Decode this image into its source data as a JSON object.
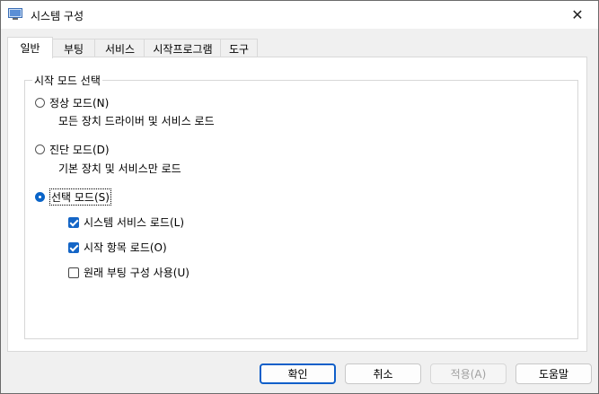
{
  "window": {
    "title": "시스템 구성",
    "close_glyph": "✕"
  },
  "tabs": [
    {
      "label": "일반",
      "active": true
    },
    {
      "label": "부팅",
      "active": false
    },
    {
      "label": "서비스",
      "active": false
    },
    {
      "label": "시작프로그램",
      "active": false
    },
    {
      "label": "도구",
      "active": false
    }
  ],
  "startup_group": {
    "legend": "시작 모드 선택",
    "normal": {
      "label": "정상 모드(N)",
      "desc": "모든 장치 드라이버 및 서비스 로드",
      "selected": false
    },
    "diagnostic": {
      "label": "진단 모드(D)",
      "desc": "기본 장치 및 서비스만 로드",
      "selected": false
    },
    "selective": {
      "label": "선택 모드(S)",
      "selected": true
    },
    "options": [
      {
        "label": "시스템 서비스 로드(L)",
        "checked": true
      },
      {
        "label": "시작 항목 로드(O)",
        "checked": true
      },
      {
        "label": "원래 부팅 구성 사용(U)",
        "checked": false
      }
    ]
  },
  "buttons": {
    "ok": "확인",
    "cancel": "취소",
    "apply": "적용(A)",
    "help": "도움말"
  },
  "colors": {
    "accent": "#1465c6"
  }
}
